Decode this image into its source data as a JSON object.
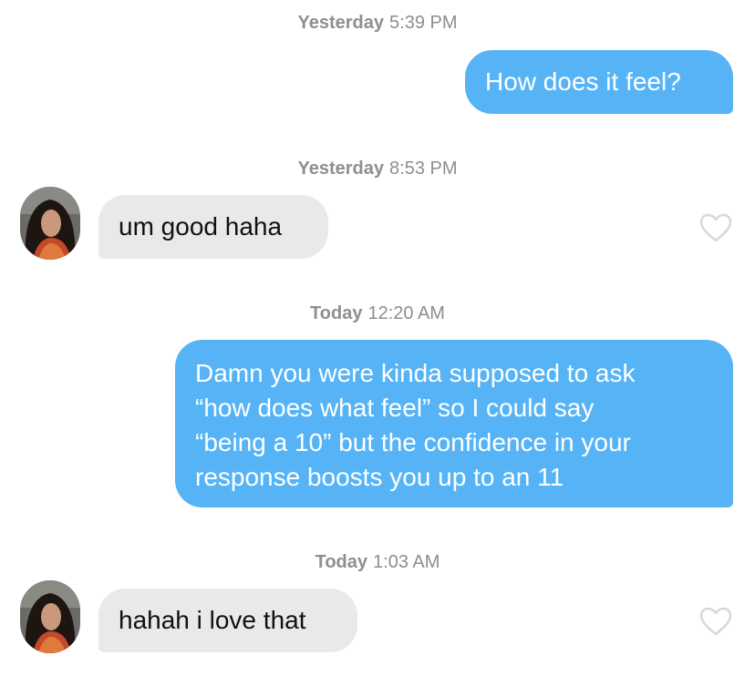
{
  "messages": [
    {
      "day": "Yesterday",
      "time": "5:39 PM",
      "direction": "sent",
      "lines": [
        "How does it feel?"
      ]
    },
    {
      "day": "Yesterday",
      "time": "8:53 PM",
      "direction": "received",
      "lines": [
        "um good haha"
      ],
      "liked": false
    },
    {
      "day": "Today",
      "time": "12:20 AM",
      "direction": "sent",
      "lines": [
        "Damn you were kinda supposed to ask",
        "“how does what feel” so I could say",
        "“being a 10” but the confidence in your",
        "response boosts you up to an 11"
      ]
    },
    {
      "day": "Today",
      "time": "1:03 AM",
      "direction": "received",
      "lines": [
        "hahah i love that"
      ],
      "liked": false
    }
  ],
  "colors": {
    "sent_bubble": "#56b4f6",
    "received_bubble": "#e9e9eb",
    "timestamp": "#8e8e93",
    "heart_outline": "#d8d8dc"
  },
  "icons": {
    "like": "heart-outline-icon",
    "avatar": "user-avatar-photo"
  }
}
